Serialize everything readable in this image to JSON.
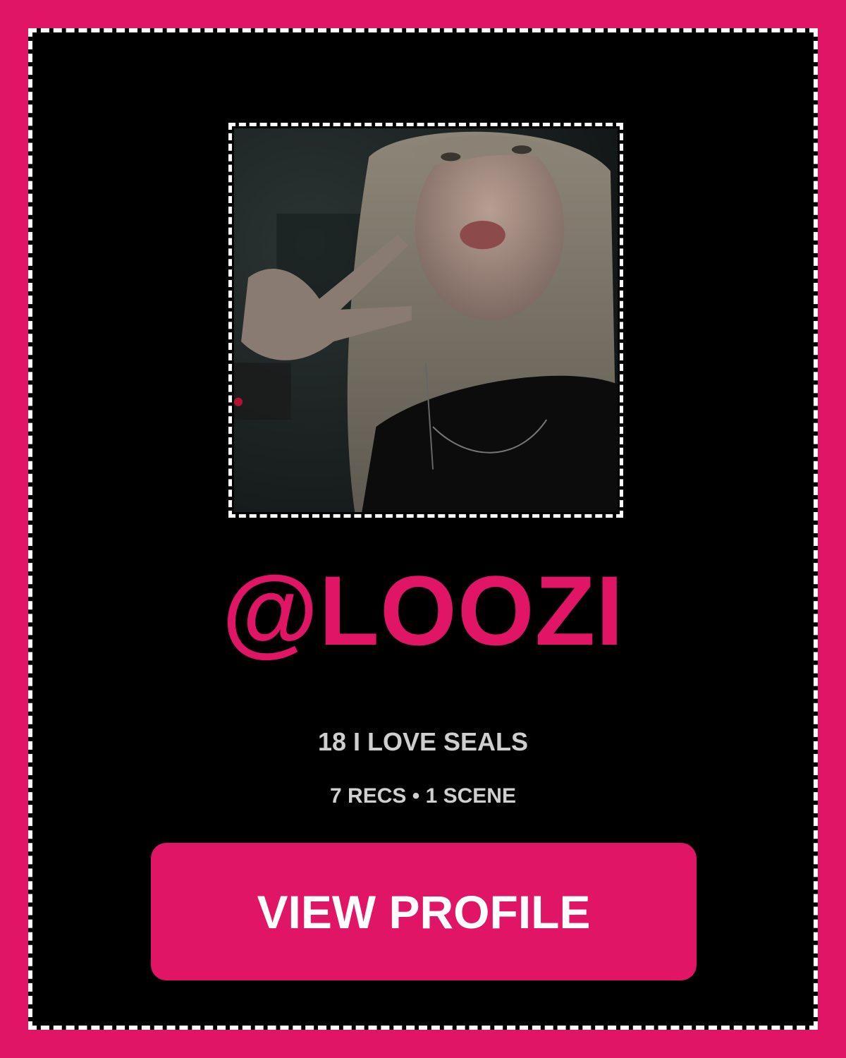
{
  "profile": {
    "username": "@LOOZI",
    "bio": "18 I LOVE SEALS",
    "stats": "7 RECS • 1 SCENE"
  },
  "actions": {
    "view_profile_label": "VIEW PROFILE"
  },
  "colors": {
    "accent": "#e01566",
    "card_background": "#000000",
    "muted_text": "#cfcfcf",
    "border": "#ffffff"
  }
}
